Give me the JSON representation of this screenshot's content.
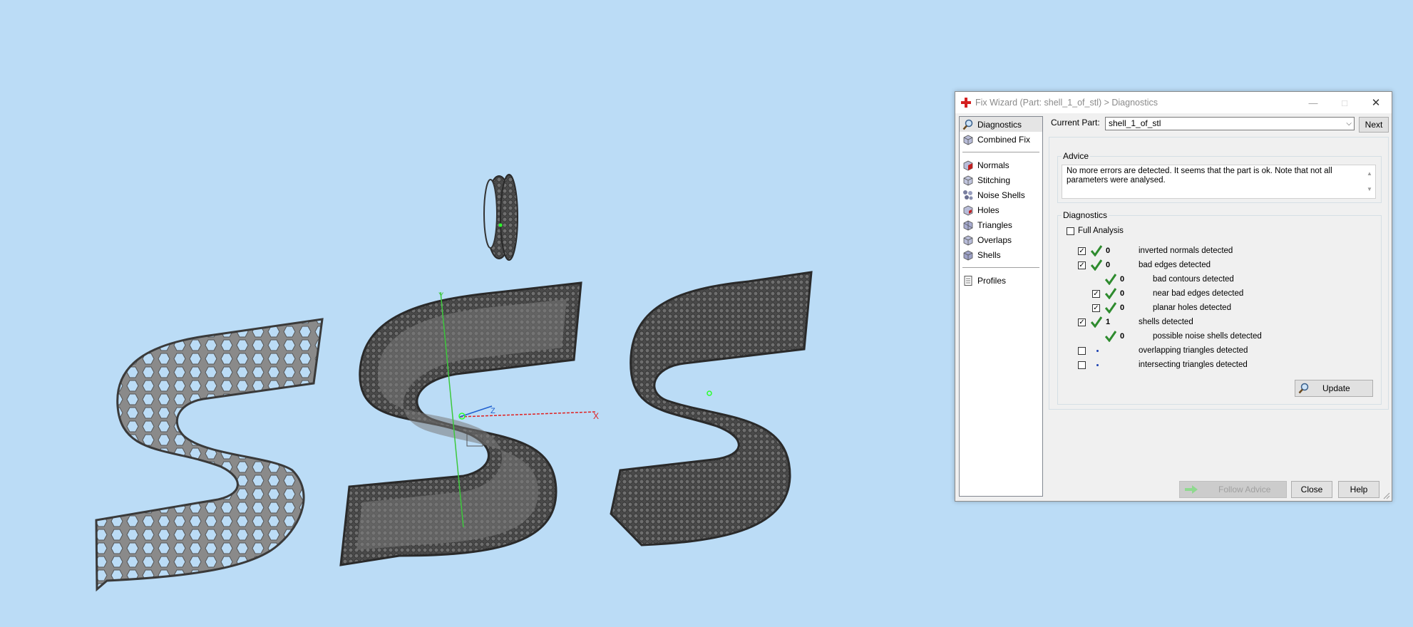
{
  "dialog": {
    "title": "Fix Wizard (Part: shell_1_of_stl) > Diagnostics",
    "window_buttons": {
      "minimize": "—",
      "maximize": "□",
      "close": "✕"
    }
  },
  "nav": {
    "items": [
      {
        "label": "Diagnostics",
        "icon": "magnifier-icon",
        "selected": true
      },
      {
        "label": "Combined Fix",
        "icon": "cube-icon"
      },
      {
        "label": "Normals",
        "icon": "normals-cube-icon"
      },
      {
        "label": "Stitching",
        "icon": "stitching-cube-icon"
      },
      {
        "label": "Noise Shells",
        "icon": "noise-shells-icon"
      },
      {
        "label": "Holes",
        "icon": "holes-cube-icon"
      },
      {
        "label": "Triangles",
        "icon": "triangles-cube-icon"
      },
      {
        "label": "Overlaps",
        "icon": "overlaps-cube-icon"
      },
      {
        "label": "Shells",
        "icon": "shells-cube-icon"
      },
      {
        "label": "Profiles",
        "icon": "document-icon"
      }
    ]
  },
  "current_part": {
    "label": "Current Part:",
    "value": "shell_1_of_stl"
  },
  "buttons": {
    "next": "Next",
    "update": "Update",
    "follow_advice": "Follow Advice",
    "close": "Close",
    "help": "Help"
  },
  "advice": {
    "title": "Advice",
    "text": "No more errors are detected. It seems that the part is ok. Note that not all parameters were analysed."
  },
  "diagnostics": {
    "title": "Diagnostics",
    "full_analysis": {
      "label": "Full Analysis",
      "checked": false
    },
    "rows": [
      {
        "label": "inverted normals detected",
        "count": "0",
        "checked": true,
        "status": "ok"
      },
      {
        "label": "bad edges detected",
        "count": "0",
        "checked": true,
        "status": "ok"
      },
      {
        "label": "bad contours detected",
        "count": "0",
        "checked": null,
        "status": "ok"
      },
      {
        "label": "near bad edges detected",
        "count": "0",
        "checked": true,
        "status": "ok"
      },
      {
        "label": "planar holes detected",
        "count": "0",
        "checked": true,
        "status": "ok"
      },
      {
        "label": "shells detected",
        "count": "1",
        "checked": true,
        "status": "ok"
      },
      {
        "label": "possible noise shells detected",
        "count": "0",
        "checked": null,
        "status": "ok"
      },
      {
        "label": "overlapping triangles detected",
        "count": "",
        "checked": false,
        "status": "not-analysed"
      },
      {
        "label": "intersecting triangles detected",
        "count": "",
        "checked": false,
        "status": "not-analysed"
      }
    ]
  },
  "viewport": {
    "axes": {
      "x": "X",
      "y": "Y",
      "z": "Z"
    },
    "colors": {
      "background": "#bbdcf6",
      "part": "#7d7d7d",
      "x_axis": "#e02020",
      "y_axis": "#3cc83c",
      "z_axis": "#2060d0"
    }
  }
}
